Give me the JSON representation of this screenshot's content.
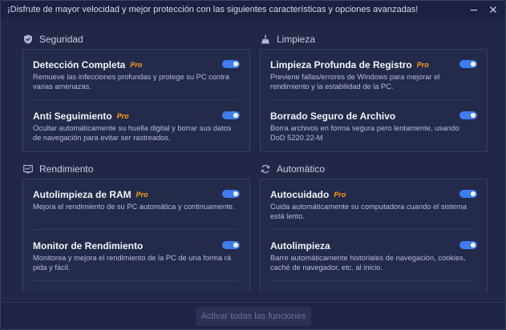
{
  "titlebar": {
    "message": "¡Disfrute de mayor velocidad y mejor protección con las siguientes características y opciones avanzadas!",
    "minimize_icon": "minimize-icon",
    "close_icon": "close-icon"
  },
  "pro_label": "Pro",
  "sections": {
    "seguridad": {
      "title": "Seguridad",
      "icon": "shield-icon",
      "items": [
        {
          "name": "Detección Completa",
          "pro": true,
          "enabled": true,
          "desc": "Remueve las infecciones profundas y protege su PC contra varias amenazas."
        },
        {
          "name": "Anti Seguimiento",
          "pro": true,
          "enabled": true,
          "desc": "Ocultar automáticamente su huella digital y borrar sus datos de navegación para evitar ser rastreados."
        }
      ]
    },
    "limpieza": {
      "title": "Limpieza",
      "icon": "broom-icon",
      "items": [
        {
          "name": "Limpieza Profunda de Registro",
          "pro": true,
          "enabled": true,
          "desc": "Previene fallas/errores de Windows para mejorar el rendimiento y la estabilidad de la PC."
        },
        {
          "name": "Borrado Seguro de Archivo",
          "pro": false,
          "enabled": true,
          "desc": "Borra archivos en forma segura pero lentamente, usando DoD 5220.22-M"
        }
      ]
    },
    "rendimiento": {
      "title": "Rendimiento",
      "icon": "monitor-chart-icon",
      "items": [
        {
          "name": "Autolimpieza de RAM",
          "pro": true,
          "enabled": true,
          "desc": "Mejora el rendimiento de su PC automática y continuamente."
        },
        {
          "name": "Monitor de Rendimiento",
          "pro": false,
          "enabled": true,
          "desc": "Monitorea y mejora el rendimiento de la PC de una forma rá pida y fácil."
        }
      ]
    },
    "automatico": {
      "title": "Automático",
      "icon": "refresh-icon",
      "items": [
        {
          "name": "Autocuidado",
          "pro": true,
          "enabled": true,
          "desc": "Cuida automáticamente su computadora cuando el sistema está lento."
        },
        {
          "name": "Autolimpieza",
          "pro": false,
          "enabled": true,
          "desc": "Barre automáticamente historiales de navegación, cookies, caché de navegador, etc. al inicio."
        }
      ]
    }
  },
  "footer": {
    "activate_all_label": "Activar todas las funciones"
  },
  "colors": {
    "accent": "#3d7cf2",
    "pro": "#ff9f1a",
    "background": "#222745"
  }
}
